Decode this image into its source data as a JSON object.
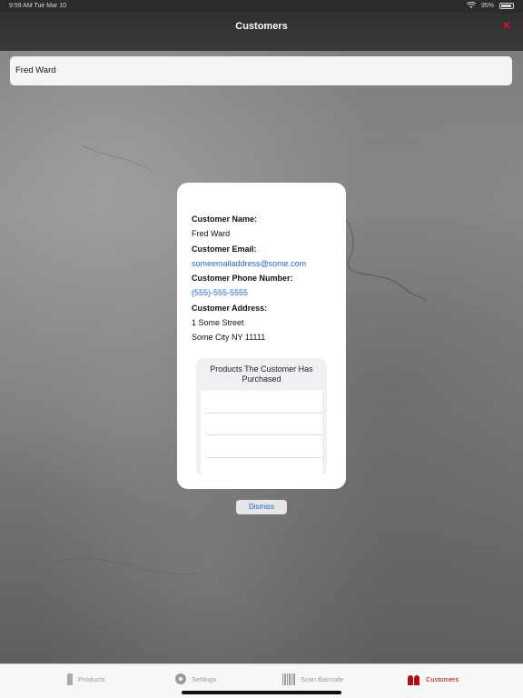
{
  "status_bar": {
    "time": "9:59 AM  Tue Mar 10",
    "battery": "95%"
  },
  "nav": {
    "title": "Customers",
    "close_icon": "close-icon",
    "close_color": "#d01818"
  },
  "search": {
    "value": "Fred Ward"
  },
  "customer_card": {
    "name_label": "Customer Name:",
    "name_value": "Fred Ward",
    "email_label": "Customer Email:",
    "email_value": "someemailaddress@some.com",
    "phone_label": "Customer Phone Number:",
    "phone_value": "(555)-555-5555",
    "address_label": "Customer Address:",
    "address_line1": "1 Some Street",
    "address_line2": "Some City NY 11111",
    "products_title": "Products The Customer Has Purchased",
    "link_color": "#1f66d6"
  },
  "dismiss_label": "Dismiss",
  "tabs": [
    {
      "label": "Products",
      "icon": "phone-icon"
    },
    {
      "label": "Settings",
      "icon": "gear-icon"
    },
    {
      "label": "Scan Barcode",
      "icon": "barcode-icon"
    },
    {
      "label": "Customers",
      "icon": "people-icon",
      "active": true
    }
  ],
  "accent_color": "#b01010"
}
